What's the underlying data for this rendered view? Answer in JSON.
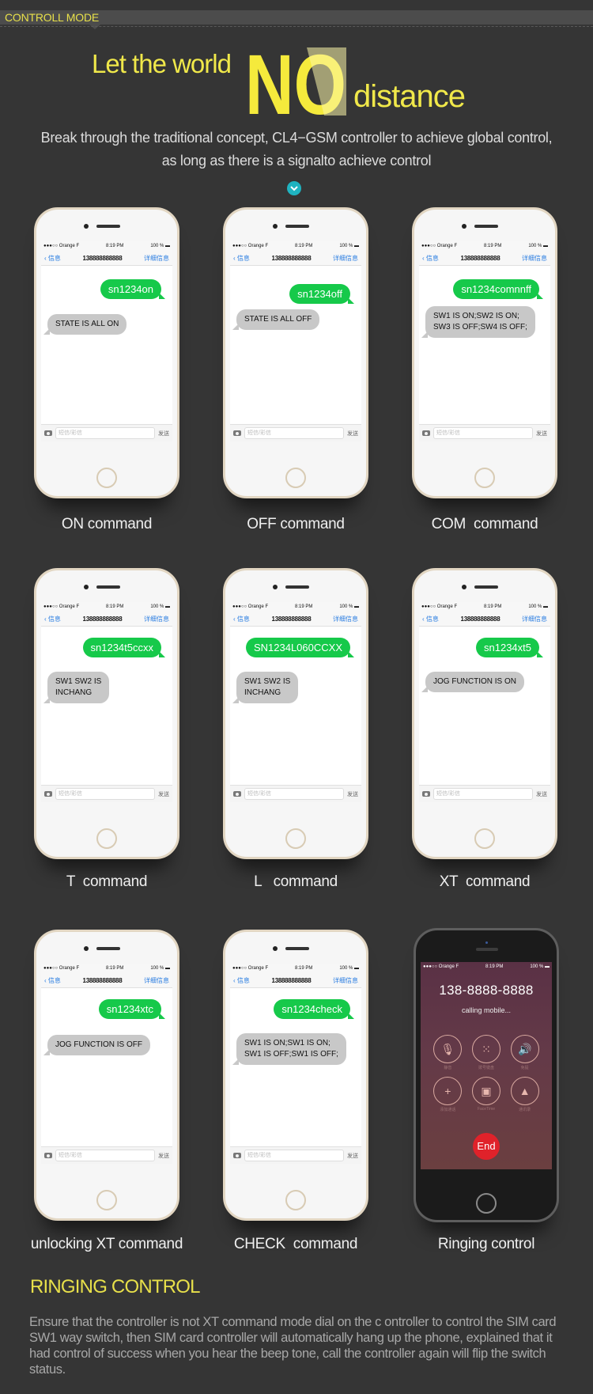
{
  "header": {
    "title": "CONTROLL MODE"
  },
  "hero": {
    "left": "Let the world",
    "big": "NO",
    "right": "distance",
    "subtitle_line1": "Break through the traditional concept, CL4−GSM controller to achieve global control,",
    "subtitle_line2": "as long as there is a signalto achieve control"
  },
  "colors": {
    "accent_yellow": "#e8e04a",
    "bubble_green": "#16c94a",
    "bubble_gray": "#c8c8c8",
    "chevron_teal": "#1fb3c0",
    "end_red": "#e0222a",
    "background": "#353535"
  },
  "phone_common": {
    "carrier": "●●●○○ Orange F",
    "wifi": "▼",
    "time": "8:19 PM",
    "battery": "100 % ▬",
    "back": "‹ 信息",
    "contact": "138888888888",
    "detail": "详细信息",
    "input_placeholder": "短信/彩信",
    "send": "发送"
  },
  "phones": [
    {
      "sent": "sn1234on",
      "reply": "STATE IS ALL ON",
      "caption": "ON command"
    },
    {
      "sent": "sn1234off",
      "reply": "STATE IS ALL OFF",
      "caption": "OFF command"
    },
    {
      "sent": "sn1234comnnff",
      "reply": "SW1 IS ON;SW2 IS ON;\nSW3 IS OFF;SW4 IS OFF;",
      "caption": "COM  command"
    },
    {
      "sent": "sn1234t5ccxx",
      "reply": "SW1 SW2 IS\nINCHANG",
      "caption": "T  command"
    },
    {
      "sent": "SN1234L060CCXX",
      "reply": "SW1 SW2 IS\nINCHANG",
      "caption": "L   command"
    },
    {
      "sent": "sn1234xt5",
      "reply": "JOG FUNCTION IS ON",
      "caption": "XT  command"
    },
    {
      "sent": "sn1234xtc",
      "reply": "JOG FUNCTION IS OFF",
      "caption": "unlocking XT command"
    },
    {
      "sent": "sn1234check",
      "reply": "SW1 IS ON;SW1 IS ON;\nSW1 IS OFF;SW1 IS OFF;",
      "caption": "CHECK  command"
    }
  ],
  "call_phone": {
    "number": "138-8888-8888",
    "status": "calling mobile...",
    "buttons": [
      {
        "icon": "mute-icon",
        "glyph": "🎙",
        "label": "静音"
      },
      {
        "icon": "keypad-icon",
        "glyph": "⁙",
        "label": "拨号键盘"
      },
      {
        "icon": "speaker-icon",
        "glyph": "🔊",
        "label": "免提"
      },
      {
        "icon": "add-call-icon",
        "glyph": "+",
        "label": "添加通话"
      },
      {
        "icon": "facetime-icon",
        "glyph": "▣",
        "label": "FaceTime"
      },
      {
        "icon": "contacts-icon",
        "glyph": "▲",
        "label": "通讯录"
      }
    ],
    "end": "End",
    "caption": "Ringing control"
  },
  "ringing": {
    "title": "RINGING CONTROL",
    "body": "Ensure  that  the controller is not XT command  mode dial on the c ontroller  to control the  SIM card SW1 way switch, then SIM card controller will automatically hang up the phone, explained that it had control of success when you hear the beep tone, call the controller again will flip the switch status."
  }
}
